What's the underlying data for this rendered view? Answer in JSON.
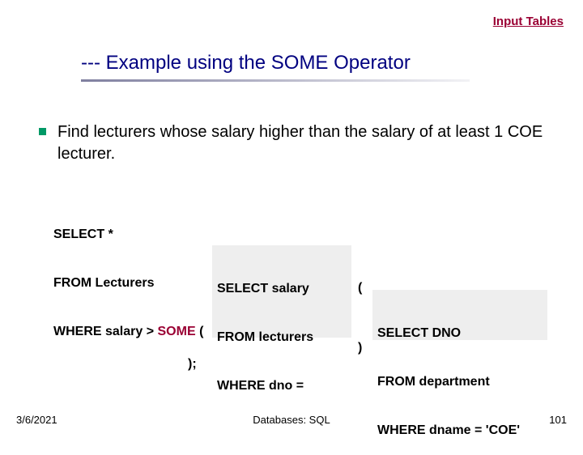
{
  "link": {
    "label": "Input Tables"
  },
  "title": {
    "text": "--- Example using the SOME Operator"
  },
  "bullet": {
    "text": "Find lecturers whose salary higher than the salary of at least 1 COE lecturer."
  },
  "sql": {
    "outer_line1": "SELECT *",
    "outer_line2": "FROM Lecturers",
    "outer_line3_pre": "WHERE salary > ",
    "outer_some": "SOME",
    "outer_line3_post": " (",
    "box1_line1": "SELECT salary",
    "box1_line2": "FROM lecturers",
    "box1_line3": "WHERE dno =",
    "paren_open": "(",
    "box2_line1": "SELECT DNO",
    "box2_line2": "FROM department",
    "box2_line3": "WHERE dname = 'COE'",
    "paren_close": ")",
    "end": ");"
  },
  "footer": {
    "date": "3/6/2021",
    "center": "Databases: SQL",
    "page": "101"
  }
}
